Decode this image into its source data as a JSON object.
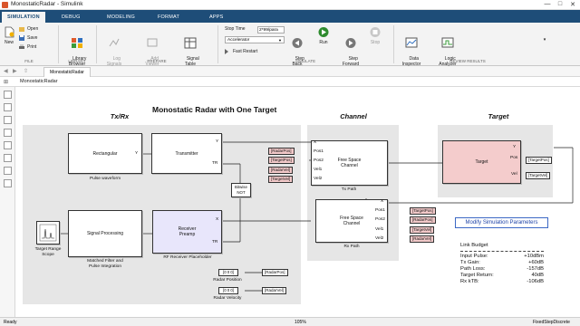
{
  "window": {
    "title": "MonostaticRadar - Simulink",
    "minimize": "—",
    "maximize": "□",
    "close": "✕"
  },
  "tabs": [
    "SIMULATION",
    "DEBUG",
    "MODELING",
    "FORMAT",
    "APPS"
  ],
  "active_tab": "SIMULATION",
  "ribbon": {
    "file": {
      "new": "New",
      "open": "Open",
      "save": "Save",
      "print": "Print",
      "section": "FILE"
    },
    "library": {
      "library_browser": "Library\nBrowser",
      "section": "LIBRARY"
    },
    "prepare": {
      "log_signals": "Log\nSignals",
      "add_viewer": "Add\nViewer",
      "signal_table": "Signal\nTable",
      "section": "PREPARE"
    },
    "simulate": {
      "stop_time_label": "Stop Time",
      "stop_time_value": "2*99/para",
      "mode": "Accelerator",
      "fast_restart": "Fast Restart",
      "step_back": "Step\nBack",
      "run": "Run",
      "step_forward": "Step\nForward",
      "stop": "Stop",
      "section": "SIMULATE"
    },
    "review": {
      "data_inspector": "Data\nInspector",
      "logic_analyzer": "Logic\nAnalyzer",
      "section": "REVIEW RESULTS"
    }
  },
  "model_tab": "MonostaticRadar",
  "breadcrumb": "MonostaticRadar",
  "diagram": {
    "title": "Monostatic Radar with One Target",
    "areas": {
      "txrx": "Tx/Rx",
      "channel": "Channel",
      "target": "Target"
    },
    "blocks": {
      "rectangular": "Rectangular",
      "pulse_waveform": "Pulse waveform",
      "transmitter": "Transmitter",
      "bitwise_not": "Bitwise\nNOT",
      "signal_processing": "Signal Processing",
      "matched_filter_caption": "Matched Filter and\nPulse Integration",
      "receiver_preamp": "Receiver\nPreamp",
      "rf_placeholder": "RF Receiver Placeholder",
      "scope_caption": "Target Range\nScope",
      "fs_channel_tx": "Free Space\nChannel",
      "tx_path": "Tx Path",
      "fs_channel_rx": "Free Space\nChannel",
      "rx_path": "Rx Path",
      "target": "Target",
      "radar_position_caption": "Radar Position",
      "radar_velocity_caption": "Radar Velocity",
      "radar_position_const": "[0 0 0]",
      "radar_velocity_const": "[0 0 0]"
    },
    "ports": {
      "y": "Y",
      "tr": "TR",
      "x": "X",
      "pos1": "Pos1",
      "pos2": "Pos2",
      "vel1": "Vel1",
      "vel2": "Vel2",
      "pos": "Pos",
      "vel": "Vel"
    },
    "tags": {
      "radar_pos": "[RadarPos]",
      "target_pos": "[TargetPos]",
      "radar_vel": "[RadarVel]",
      "target_vel": "[TargetVel]"
    },
    "modify_button": "Modify Simulation Parameters",
    "link_budget": {
      "title": "Link Budget",
      "rows": [
        {
          "label": "Input Pulse:",
          "value": "+10dBm"
        },
        {
          "label": "Tx Gain:",
          "value": "+60dB"
        },
        {
          "label": "Path Loss:",
          "value": "-157dB"
        },
        {
          "label": "Target Return:",
          "value": "40dB"
        },
        {
          "label": "Rx kTB:",
          "value": "-106dB"
        }
      ]
    }
  },
  "status": {
    "left": "Ready",
    "zoom": "105%",
    "solver": "FixedStepDiscrete"
  },
  "colors": {
    "ribbon_tab_bar": "#1e4d78",
    "tag_fill": "#f2c9c9",
    "area_fill": "#e6e6e6",
    "target_fill": "#f4cccc",
    "preamp_fill": "#e8e6fb",
    "run_green": "#2e8b2e"
  }
}
